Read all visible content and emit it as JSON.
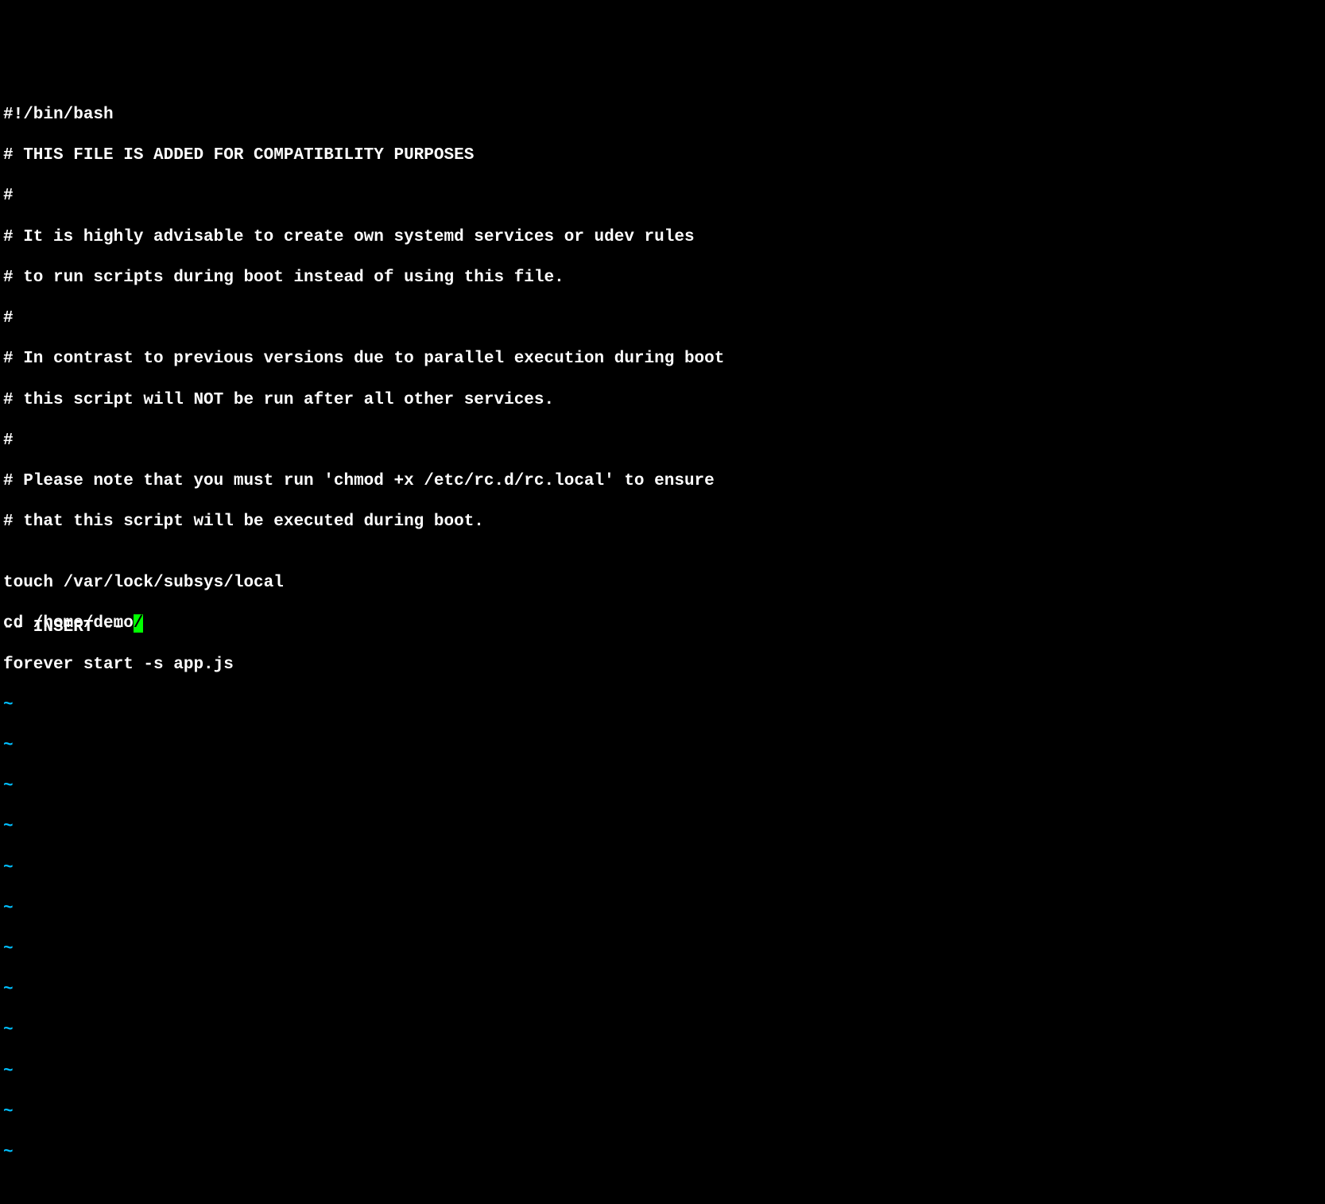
{
  "editor": {
    "lines": [
      "#!/bin/bash",
      "# THIS FILE IS ADDED FOR COMPATIBILITY PURPOSES",
      "#",
      "# It is highly advisable to create own systemd services or udev rules",
      "# to run scripts during boot instead of using this file.",
      "#",
      "# In contrast to previous versions due to parallel execution during boot",
      "# this script will NOT be run after all other services.",
      "#",
      "# Please note that you must run 'chmod +x /etc/rc.d/rc.local' to ensure",
      "# that this script will be executed during boot.",
      "",
      "touch /var/lock/subsys/local"
    ],
    "cursor_line_before": "cd /home/demo",
    "cursor_char": "/",
    "line_after_cursor": "forever start -s app.js",
    "tilde": "~",
    "mode": "-- INSERT --"
  }
}
